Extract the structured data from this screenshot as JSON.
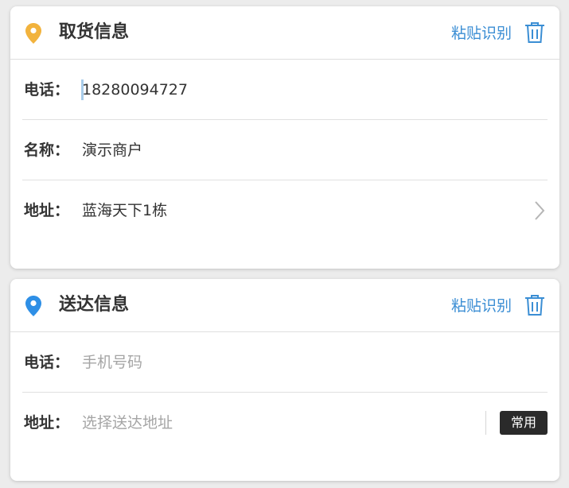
{
  "colors": {
    "accent": "#3b8ed4",
    "pickup_pin": "#f2b33d",
    "delivery_pin": "#2e8fe6",
    "badge_bg": "#2a2a2a"
  },
  "pickup": {
    "title": "取货信息",
    "paste_label": "粘贴识别",
    "phone_label": "电话：",
    "phone_value": "18280094727",
    "name_label": "名称：",
    "name_value": "演示商户",
    "address_label": "地址：",
    "address_value": "蓝海天下1栋",
    "icons": {
      "pin": "location-pin-icon",
      "trash": "trash-icon",
      "chevron": "chevron-right-icon"
    }
  },
  "delivery": {
    "title": "送达信息",
    "paste_label": "粘贴识别",
    "phone_label": "电话：",
    "phone_placeholder": "手机号码",
    "address_label": "地址：",
    "address_placeholder": "选择送达地址",
    "common_label": "常用",
    "icons": {
      "pin": "location-pin-icon",
      "trash": "trash-icon"
    }
  }
}
